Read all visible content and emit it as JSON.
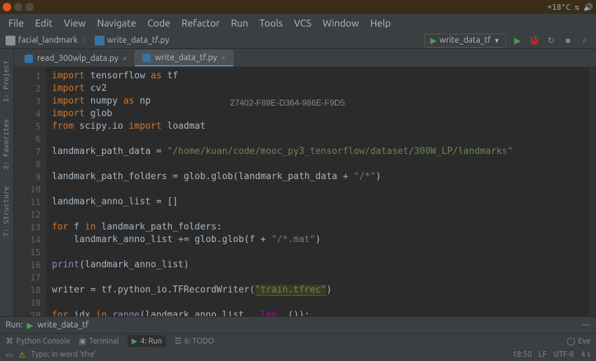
{
  "titlebar": {
    "weather": "☀18°C"
  },
  "menubar": {
    "file": "File",
    "edit": "Edit",
    "view": "View",
    "navigate": "Navigate",
    "code": "Code",
    "refactor": "Refactor",
    "run": "Run",
    "tools": "Tools",
    "vcs": "VCS",
    "window": "Window",
    "help": "Help"
  },
  "navbar": {
    "project": "facial_landmark",
    "file": "write_data_tf.py",
    "run_config": "write_data_tf"
  },
  "sidebar": {
    "project": "1: Project",
    "favorites": "2: Favorites",
    "structure": "7: Structure"
  },
  "tabs": {
    "t0": "read_300wlp_data.py",
    "t1": "write_data_tf.py"
  },
  "gutter": {
    "l1": "1",
    "l2": "2",
    "l3": "3",
    "l4": "4",
    "l5": "5",
    "l6": "6",
    "l7": "7",
    "l8": "8",
    "l9": "9",
    "l10": "10",
    "l11": "11",
    "l12": "12",
    "l13": "13",
    "l14": "14",
    "l15": "15",
    "l16": "16",
    "l17": "17",
    "l18": "18",
    "l19": "19",
    "l20": "20"
  },
  "code": {
    "import": "import",
    "from": "from",
    "as": "as",
    "for": "for",
    "in": "in",
    "tensorflow": " tensorflow ",
    "tf": " tf",
    "cv2": " cv2",
    "numpy": " numpy ",
    "np": " np",
    "glob": " glob",
    "scipy": " scipy.io ",
    "loadmat": " loadmat",
    "lpd": "landmark_path_data = ",
    "lpd_str": "\"/home/kuan/code/mooc_py3_tensorflow/dataset/300W_LP/landmarks\"",
    "lpf_left": "landmark_path_folders = glob.glob(landmark_path_data + ",
    "lpf_str": "\"/*\"",
    "lpf_right": ")",
    "lal": "landmark_anno_list = []",
    "for_f": " f ",
    "for_folders": " landmark_path_folders:",
    "append_l": "    landmark_anno_list += glob.glob(f + ",
    "append_str": "\"/*.mat\"",
    "append_r": ")",
    "print": "print",
    "print_arg": "(landmark_anno_list)",
    "writer_l": "writer = tf.python_io.TFRecordWriter(",
    "writer_str": "\"train.tfrec\"",
    "writer_r": ")",
    "for_idx": " idx ",
    "range": "range",
    "range_arg_l": "(landmark_anno_list.",
    "len": "__len__",
    "range_arg_r": "()):"
  },
  "watermark": "27402-F89E-D364-986E-F9D5",
  "runpanel": {
    "label": "Run:",
    "config": "write_data_tf"
  },
  "bottomtabs": {
    "pyconsole": "Python Console",
    "terminal": "Terminal",
    "run": "4: Run",
    "todo": "6: TODO",
    "eventlog": "Eve"
  },
  "statusbar": {
    "typo": "Typo: In word 'tfre'",
    "pos": "18:50",
    "sep": "LF",
    "enc": "UTF-8",
    "indent": "4 s"
  }
}
